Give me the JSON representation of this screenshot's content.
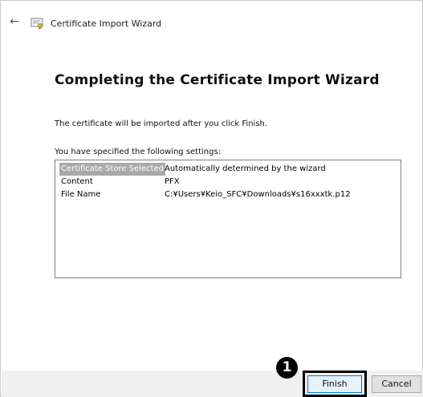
{
  "window": {
    "title": "Certificate Import Wizard",
    "back_icon": "back-arrow-icon",
    "cert_icon": "certificate-icon"
  },
  "wizard": {
    "heading": "Completing the Certificate Import Wizard",
    "info_text": "The certificate will be imported after you click Finish.",
    "settings_label": "You have specified the following settings:",
    "settings": [
      {
        "key": "Certificate Store Selected",
        "value": "Automatically determined by the wizard",
        "selected": true
      },
      {
        "key": "Content",
        "value": "PFX",
        "selected": false
      },
      {
        "key": "File Name",
        "value": "C:¥Users¥Keio_SFC¥Downloads¥s16xxxtk.p12",
        "selected": false
      }
    ]
  },
  "footer": {
    "finish_label": "Finish",
    "cancel_label": "Cancel"
  },
  "annotation": {
    "marker_label": "1"
  },
  "colors": {
    "highlight": "#000000",
    "selected_row_bg": "#a9a9a9",
    "footer_bg": "#f0f0f0",
    "focus_border": "#0078d7"
  }
}
